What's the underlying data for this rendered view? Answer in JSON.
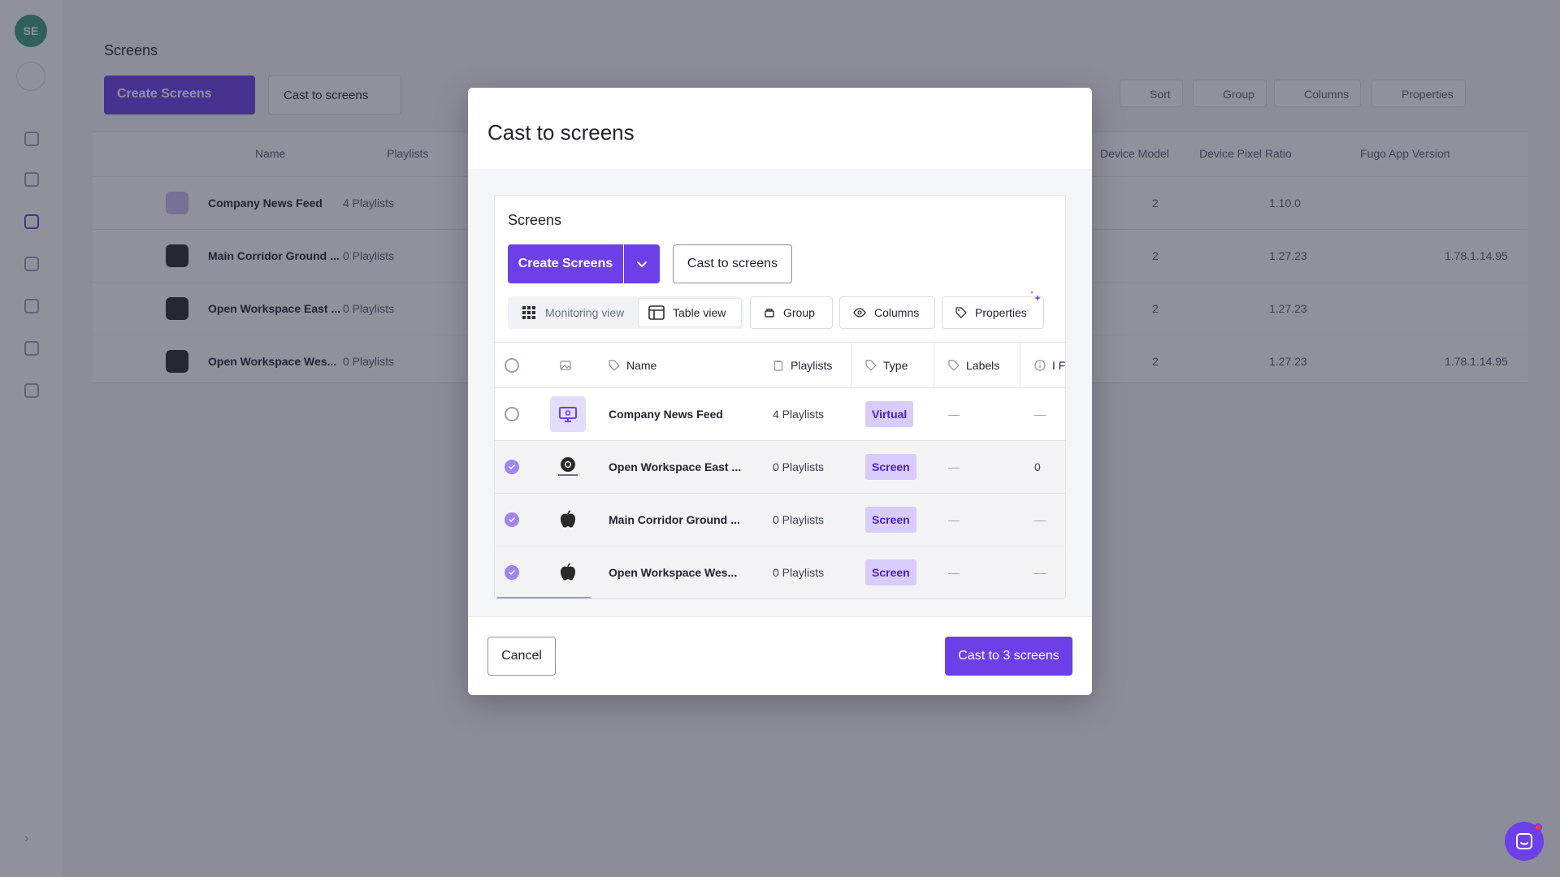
{
  "background": {
    "avatar_initials": "SE",
    "page_title": "Screens",
    "create_label": "Create Screens",
    "cast_label": "Cast to screens",
    "toolbar": [
      "Sort",
      "Group",
      "Columns",
      "Properties"
    ],
    "columns": [
      "Name",
      "Playlists",
      "Device Model",
      "Device Pixel Ratio",
      "Fugo App Version"
    ],
    "rows": [
      {
        "name": "Company News Feed",
        "playlists": "4 Playlists",
        "c1": "2",
        "c2": "1.10.0",
        "c3": ""
      },
      {
        "name": "Main Corridor Ground ...",
        "playlists": "0 Playlists",
        "c1": "2",
        "c2": "1.27.23",
        "c3": "1.78.1.14.95"
      },
      {
        "name": "Open Workspace East ...",
        "playlists": "0 Playlists",
        "c1": "2",
        "c2": "1.27.23",
        "c3": ""
      },
      {
        "name": "Open Workspace Wes...",
        "playlists": "0 Playlists",
        "c1": "2",
        "c2": "1.27.23",
        "c3": "1.78.1.14.95"
      }
    ]
  },
  "modal": {
    "title": "Cast to screens",
    "panel_title": "Screens",
    "create_label": "Create Screens",
    "cast_label": "Cast to screens",
    "monitoring_view": "Monitoring view",
    "table_view": "Table view",
    "group": "Group",
    "columns": "Columns",
    "properties": "Properties",
    "headers": {
      "name": "Name",
      "playlists": "Playlists",
      "type": "Type",
      "labels": "Labels",
      "extra": "I F"
    },
    "rows": [
      {
        "name": "Company News Feed",
        "playlists": "4 Playlists",
        "type": "Virtual",
        "labels": "—",
        "extra": "—",
        "selected": false,
        "icon": "monitor-icon"
      },
      {
        "name": "Open Workspace East ...",
        "playlists": "0 Playlists",
        "type": "Screen",
        "labels": "—",
        "extra": "0",
        "selected": true,
        "icon": "chrome-extension-icon"
      },
      {
        "name": "Main Corridor Ground ...",
        "playlists": "0 Playlists",
        "type": "Screen",
        "labels": "—",
        "extra": "—",
        "selected": true,
        "icon": "apple-icon"
      },
      {
        "name": "Open Workspace Wes...",
        "playlists": "0 Playlists",
        "type": "Screen",
        "labels": "—",
        "extra": "—",
        "selected": true,
        "icon": "apple-icon"
      }
    ],
    "cancel_label": "Cancel",
    "submit_label": "Cast to 3 screens"
  },
  "colors": {
    "accent": "#6c3fe8",
    "badge_bg": "#d8ccfa",
    "badge_text": "#4b1fc6"
  }
}
